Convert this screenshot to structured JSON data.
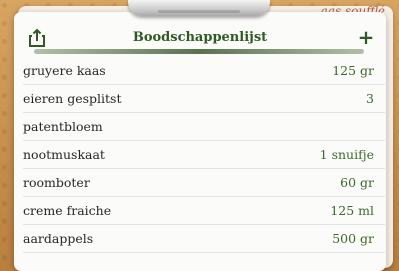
{
  "header": {
    "title": "Boodschappenlijst",
    "share_icon": "share-icon",
    "add_icon": "plus-icon",
    "add_symbol": "+"
  },
  "background_peek_text": "aas soufflé",
  "items": [
    {
      "name": "gruyere kaas",
      "quantity": "125 gr"
    },
    {
      "name": "eieren gesplitst",
      "quantity": "3"
    },
    {
      "name": "patentbloem",
      "quantity": ""
    },
    {
      "name": "nootmuskaat",
      "quantity": "1 snuifje"
    },
    {
      "name": "roomboter",
      "quantity": "60 gr"
    },
    {
      "name": "creme fraiche",
      "quantity": "125 ml"
    },
    {
      "name": "aardappels",
      "quantity": "500 gr"
    }
  ],
  "colors": {
    "accent": "#2f5a23",
    "quantity": "#3b6a2b",
    "text": "#262626",
    "paper": "#fbfbf9"
  }
}
